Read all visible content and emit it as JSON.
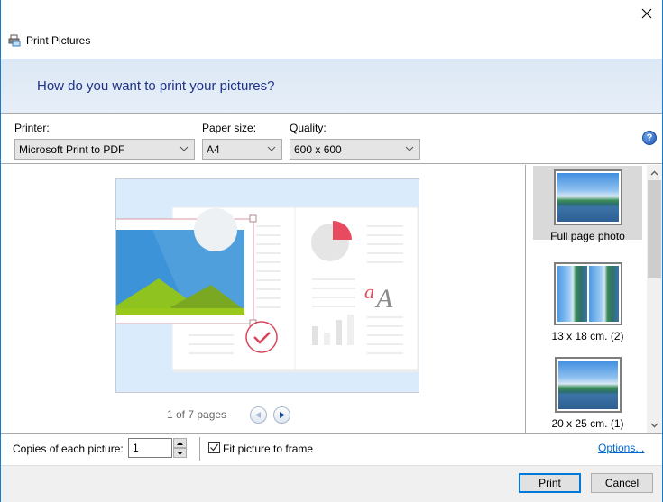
{
  "window": {
    "title": "Print Pictures",
    "close_label": "Close"
  },
  "banner": {
    "heading": "How do you want to print your pictures?"
  },
  "options": {
    "printer": {
      "label": "Printer:",
      "value": "Microsoft Print to PDF"
    },
    "paper_size": {
      "label": "Paper size:",
      "value": "A4"
    },
    "quality": {
      "label": "Quality:",
      "value": "600 x 600"
    },
    "help_glyph": "?"
  },
  "preview": {
    "pager_text": "1 of 7 pages",
    "current_page": 1,
    "total_pages": 7
  },
  "layouts": {
    "items": [
      {
        "label": "Full page photo",
        "selected": true
      },
      {
        "label": "13 x 18 cm. (2)",
        "selected": false
      },
      {
        "label": "20 x 25 cm. (1)",
        "selected": false
      }
    ]
  },
  "bottom": {
    "copies_label": "Copies of each picture:",
    "copies_value": "1",
    "fit_label": "Fit picture to frame",
    "fit_checked": true,
    "options_link": "Options..."
  },
  "footer": {
    "print_label": "Print",
    "cancel_label": "Cancel"
  },
  "colors": {
    "accent": "#0078d7",
    "banner_text": "#1e3287",
    "link": "#0066cc",
    "preview_red": "#e84a5f"
  }
}
